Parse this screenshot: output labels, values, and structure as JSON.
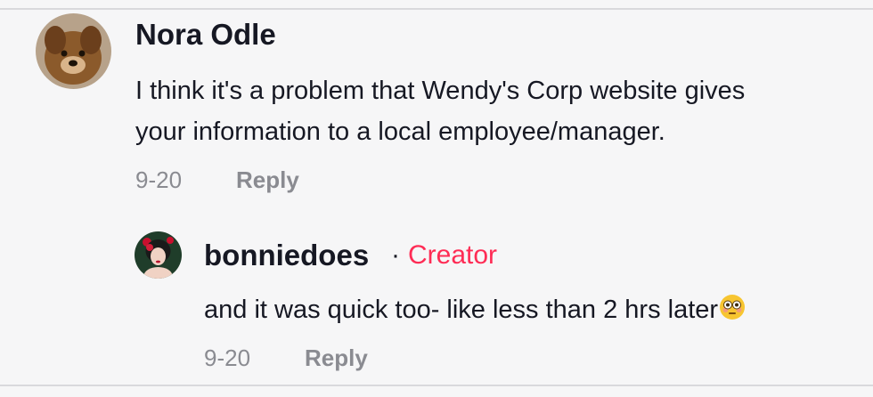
{
  "comment": {
    "username": "Nora Odle",
    "text_line1": "I think it's a problem that Wendy's Corp website gives",
    "text_line2": "your information to a local employee/manager.",
    "date": "9-20",
    "reply_label": "Reply"
  },
  "reply": {
    "username": "bonniedoes",
    "separator": "·",
    "badge": "Creator",
    "text": "and it was quick too- like less than 2 hrs later",
    "emoji": "😳",
    "date": "9-20",
    "reply_label": "Reply"
  },
  "colors": {
    "creator_badge": "#fe2c55",
    "meta_text": "#8a8b91",
    "primary_text": "#161823"
  }
}
